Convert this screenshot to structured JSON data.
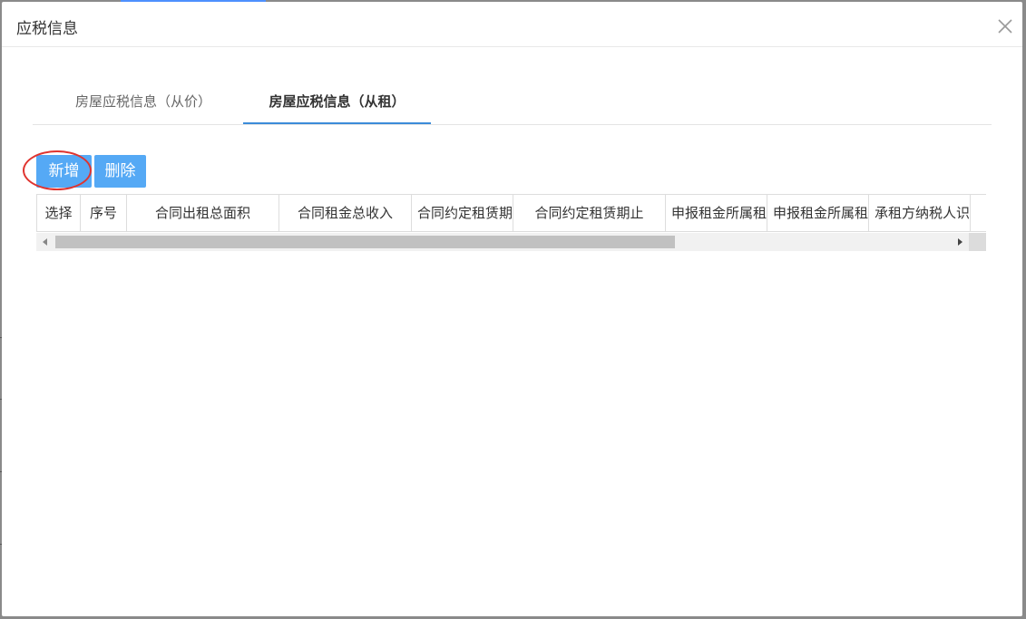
{
  "dialog": {
    "title": "应税信息",
    "close_icon": "close-icon"
  },
  "tabs": [
    {
      "label": "房屋应税信息（从价）",
      "active": false
    },
    {
      "label": "房屋应税信息（从租）",
      "active": true
    }
  ],
  "toolbar": {
    "add_label": "新增",
    "delete_label": "删除"
  },
  "table": {
    "columns": [
      "选择",
      "序号",
      "合同出租总面积",
      "合同租金总收入",
      "合同约定租赁期起",
      "合同约定租赁期止",
      "申报租金所属租赁期起",
      "申报租金所属租赁期止",
      "承租方纳税人识别号"
    ],
    "rows": []
  },
  "colors": {
    "accent": "#55a9f5",
    "tab_underline": "#3b8cd9",
    "highlight_circle": "#e0342f"
  }
}
